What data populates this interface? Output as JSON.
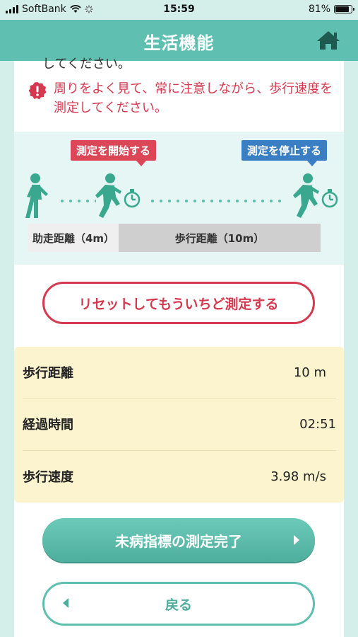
{
  "status_bar": {
    "carrier": "SoftBank",
    "time": "15:59",
    "battery": "81%"
  },
  "header": {
    "title": "生活機能",
    "home_icon": "home-icon"
  },
  "content": {
    "cutoff_text": "してください。",
    "warning_icon": "exclamation-icon",
    "warning_text": "周りをよく見て、常に注意しながら、歩行速度を測定してください。",
    "diagram": {
      "start_label": "測定を開始する",
      "stop_label": "測定を停止する",
      "run_up_label": "助走距離（4m）",
      "walk_label": "歩行距離（10m）"
    },
    "reset_button": "リセットしてもういちど測定する",
    "results": [
      {
        "label": "歩行距離",
        "value": "10 m"
      },
      {
        "label": "経過時間",
        "value": "02:51"
      },
      {
        "label": "歩行速度",
        "value": "3.98 m/s"
      }
    ],
    "complete_button": "未病指標の測定完了",
    "back_button": "戻る"
  },
  "colors": {
    "teal": "#5fbfb0",
    "red": "#d6394f",
    "blue": "#3a7fc4",
    "results_bg": "#fbf4cf"
  }
}
